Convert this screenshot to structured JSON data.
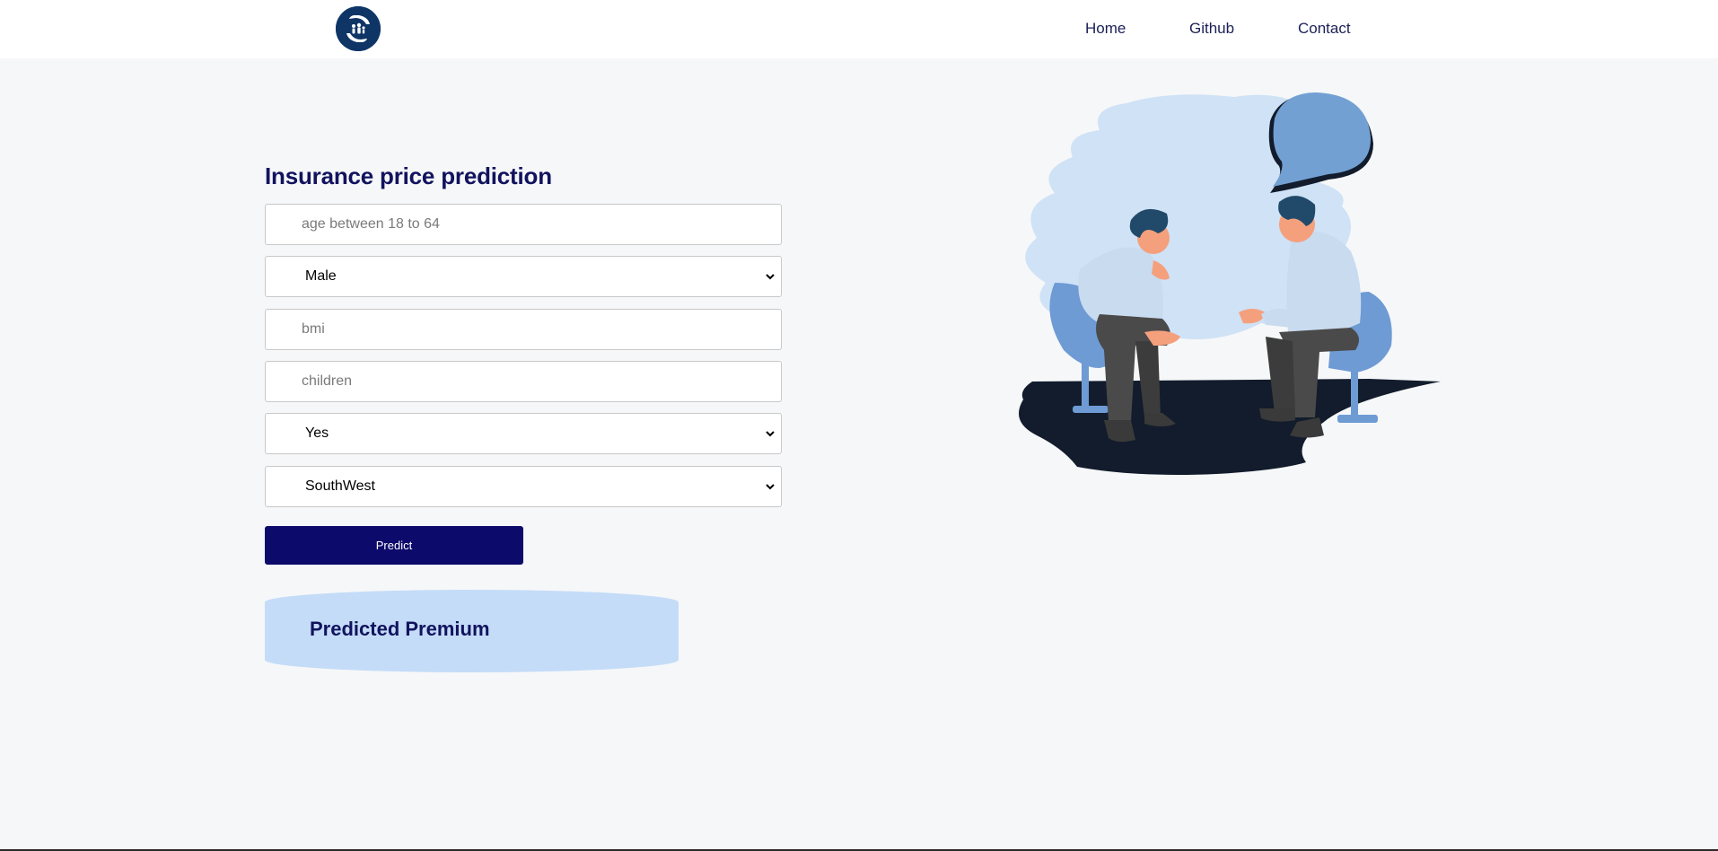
{
  "nav": {
    "logo_icon": "family-care-hands-icon",
    "links": [
      "Home",
      "Github",
      "Contact"
    ]
  },
  "form": {
    "title": "Insurance price prediction",
    "age": {
      "placeholder": "age between 18 to 64",
      "value": ""
    },
    "sex": {
      "selected": "Male"
    },
    "bmi": {
      "placeholder": "bmi",
      "value": ""
    },
    "children": {
      "placeholder": "children",
      "value": ""
    },
    "smoker": {
      "selected": "Yes"
    },
    "region": {
      "selected": "SouthWest"
    },
    "predict_label": "Predict"
  },
  "result": {
    "title": "Predicted Premium"
  },
  "illustration": {
    "icon": "two-people-conversation-illustration"
  },
  "colors": {
    "brand_navy": "#0c0a6b",
    "heading": "#12135e",
    "result_bg": "#c4dcf8",
    "logo_bg": "#0e3566",
    "page_bg": "#f6f7f9"
  }
}
